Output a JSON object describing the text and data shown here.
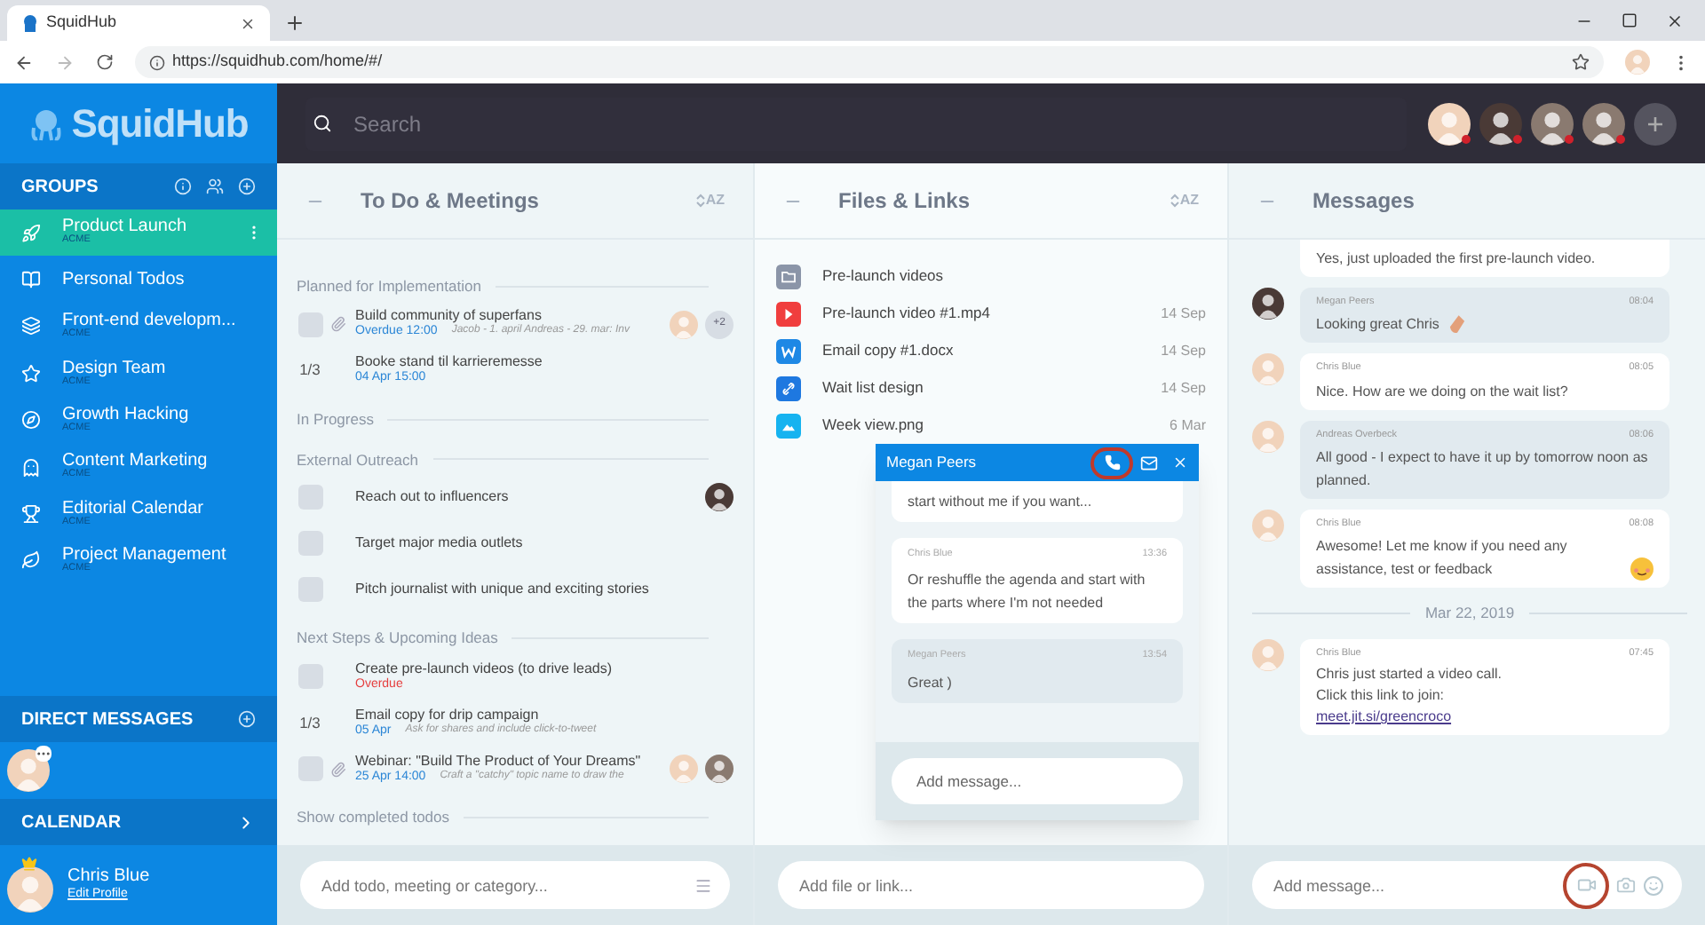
{
  "browser": {
    "tab_title": "SquidHub",
    "url": "https://squidhub.com/home/#/"
  },
  "sidebar": {
    "logo": "SquidHub",
    "groups_title": "GROUPS",
    "groups": [
      {
        "name": "Product Launch",
        "org": "ACME",
        "selected": true
      },
      {
        "name": "Personal Todos",
        "selected": false
      },
      {
        "name": "Front-end developm...",
        "org": "ACME",
        "selected": false
      },
      {
        "name": "Design Team",
        "org": "ACME",
        "selected": false
      },
      {
        "name": "Growth Hacking",
        "org": "ACME",
        "selected": false
      },
      {
        "name": "Content Marketing",
        "org": "ACME",
        "selected": false
      },
      {
        "name": "Editorial Calendar",
        "org": "ACME",
        "selected": false
      },
      {
        "name": "Project Management",
        "org": "ACME",
        "selected": false
      }
    ],
    "direct_messages_title": "DIRECT MESSAGES",
    "calendar_title": "CALENDAR",
    "profile": {
      "name": "Chris Blue",
      "link": "Edit Profile"
    }
  },
  "topbar": {
    "search_placeholder": "Search",
    "members": [
      {
        "kind": "man",
        "busy": true
      },
      {
        "kind": "woman",
        "busy": true
      },
      {
        "kind": "person",
        "busy": true
      },
      {
        "kind": "person",
        "busy": true
      }
    ]
  },
  "todos": {
    "title": "To Do & Meetings",
    "sort": "AZ",
    "sections": [
      {
        "title": "Planned for Implementation",
        "items": [
          {
            "kind": "checkbox",
            "checked": false,
            "attachment": true,
            "title": "Build community of superfans",
            "due": "Overdue 12:00",
            "overdue": false,
            "note": "Jacob - 1. april Andreas - 29. mar: Inv",
            "assignees": [
              {
                "kind": "man"
              }
            ],
            "extra": "+2"
          },
          {
            "kind": "progress",
            "progress": "1/3",
            "attachment": false,
            "title": "Booke stand til karrieremesse",
            "due": "04 Apr 15:00",
            "overdue": false
          }
        ]
      },
      {
        "title": "In Progress"
      },
      {
        "title": "External Outreach",
        "items": [
          {
            "kind": "checkbox",
            "checked": false,
            "attachment": false,
            "title": "Reach out to influencers",
            "assignees": [
              {
                "kind": "woman"
              }
            ]
          },
          {
            "kind": "checkbox",
            "checked": false,
            "attachment": false,
            "title": "Target major media outlets"
          },
          {
            "kind": "checkbox",
            "checked": false,
            "attachment": false,
            "title": "Pitch journalist with unique and exciting stories"
          }
        ]
      },
      {
        "title": "Next Steps & Upcoming Ideas",
        "items": [
          {
            "kind": "checkbox",
            "checked": false,
            "attachment": false,
            "title": "Create pre-launch videos (to drive leads)",
            "due": "Overdue",
            "overdue": true
          },
          {
            "kind": "progress",
            "progress": "1/3",
            "attachment": false,
            "title": "Email copy for drip campaign",
            "due": "05 Apr",
            "overdue": false,
            "note": "Ask for shares and include click-to-tweet"
          },
          {
            "kind": "checkbox",
            "checked": false,
            "attachment": true,
            "title": "Webinar: \"Build The Product of Your Dreams\"",
            "due": "25 Apr 14:00",
            "overdue": false,
            "note": "Craft a \"catchy\" topic name to draw the",
            "assignees": [
              {
                "kind": "man"
              },
              {
                "kind": "person"
              }
            ]
          }
        ]
      },
      {
        "title": "Show completed todos"
      }
    ],
    "composer_placeholder": "Add todo, meeting or category..."
  },
  "files": {
    "title": "Files & Links",
    "sort": "AZ",
    "items": [
      {
        "kind": "folder",
        "name": "Pre-launch videos"
      },
      {
        "kind": "video",
        "name": "Pre-launch video #1.mp4",
        "date": "14 Sep"
      },
      {
        "kind": "doc",
        "name": "Email copy #1.docx",
        "date": "14 Sep"
      },
      {
        "kind": "link",
        "name": "Wait list design",
        "date": "14 Sep"
      },
      {
        "kind": "image",
        "name": "Week view.png",
        "date": "6 Mar"
      }
    ],
    "composer_placeholder": "Add file or link..."
  },
  "chat_popup": {
    "title": "Megan Peers",
    "call_highlighted": true,
    "messages": [
      {
        "mine": true,
        "text": "start without me if you want..."
      },
      {
        "mine": true,
        "author": "Chris Blue",
        "time": "13:36",
        "text": "Or reshuffle the agenda and start with the parts where I'm not needed"
      },
      {
        "mine": false,
        "author": "Megan Peers",
        "time": "13:54",
        "text": "Great )"
      }
    ],
    "composer_placeholder": "Add message..."
  },
  "messages": {
    "title": "Messages",
    "items": [
      {
        "kind": "message",
        "mine": true,
        "text": "Yes, just uploaded the first pre-launch video."
      },
      {
        "kind": "message",
        "mine": false,
        "avatar": {
          "kind": "woman"
        },
        "author": "Megan Peers",
        "time": "08:04",
        "text": "Looking great Chris",
        "emoji": {
          "kind": "clap"
        }
      },
      {
        "kind": "message",
        "mine": true,
        "avatar": {
          "kind": "man"
        },
        "author": "Chris Blue",
        "time": "08:05",
        "text": "Nice. How are we doing on the wait list?"
      },
      {
        "kind": "message",
        "mine": false,
        "avatar": {
          "kind": "man"
        },
        "author": "Andreas Overbeck",
        "time": "08:06",
        "text": "All good - I expect to have it up by tomorrow noon as planned."
      },
      {
        "kind": "message",
        "mine": true,
        "avatar": {
          "kind": "man"
        },
        "author": "Chris Blue",
        "time": "08:08",
        "text": "Awesome! Let me know if you need any assistance, test or feedback",
        "emoji": {
          "kind": "blush"
        }
      },
      {
        "kind": "date",
        "text": "Mar 22, 2019"
      },
      {
        "kind": "message",
        "mine": true,
        "avatar": {
          "kind": "man"
        },
        "author": "Chris Blue",
        "time": "07:45",
        "lines": [
          "Chris just started a video call.",
          "Click this link to join:"
        ],
        "link": "meet.jit.si/greencroco"
      }
    ],
    "composer_placeholder": "Add message...",
    "video_highlighted": true
  }
}
